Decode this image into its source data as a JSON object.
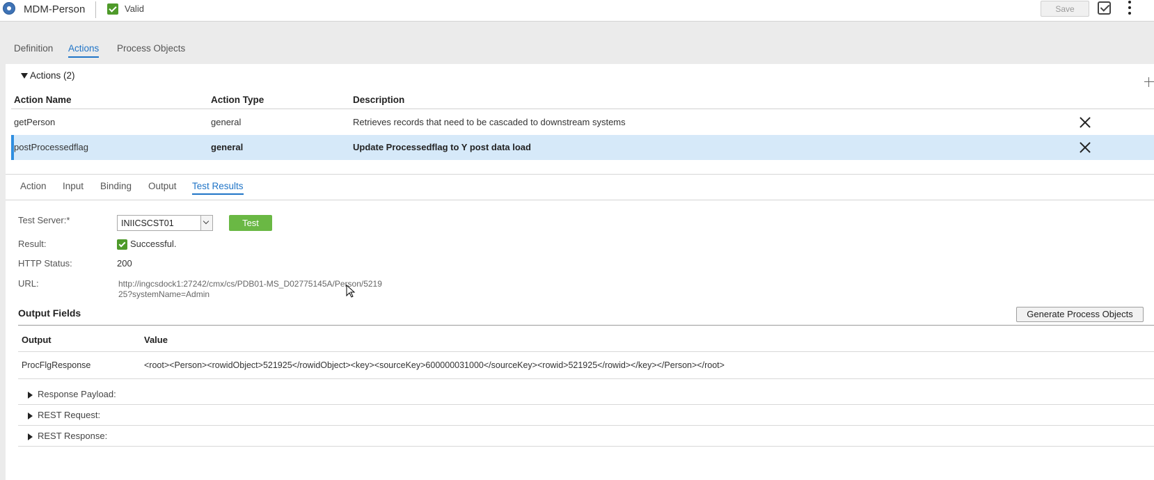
{
  "topbar": {
    "app_title": "MDM-Person",
    "status": "Valid",
    "save_label": "Save",
    "icons": [
      "app-logo-icon",
      "check-icon",
      "validate-icon",
      "kebab-menu-icon"
    ]
  },
  "main_tabs": [
    "Definition",
    "Actions",
    "Process Objects"
  ],
  "main_active_tab": "Actions",
  "actions_section": {
    "title": "Actions (2)",
    "columns": [
      "Action Name",
      "Action Type",
      "Description"
    ],
    "rows": [
      {
        "name": "getPerson",
        "type": "general",
        "description": "Retrieves records that need to be cascaded to downstream systems"
      },
      {
        "name": "postProcessedflag",
        "type": "general",
        "description": "Update Processedflag to Y post data load"
      }
    ],
    "selected_row": "postProcessedflag"
  },
  "sub_tabs": [
    "Action",
    "Input",
    "Binding",
    "Output",
    "Test Results"
  ],
  "sub_active_tab": "Test Results",
  "test_results": {
    "server_label": "Test Server:*",
    "server_value": "INIICSCST01",
    "test_button": "Test",
    "result_label": "Result:",
    "result_value": "Successful.",
    "http_status_label": "HTTP Status:",
    "http_status_value": "200",
    "url_label": "URL:",
    "url_value": "http://ingcsdock1:27242/cmx/cs/PDB01-MS_D02775145A/Person/521925?systemName=Admin"
  },
  "output_fields": {
    "title": "Output Fields",
    "generate_button": "Generate Process Objects",
    "columns": [
      "Output",
      "Value"
    ],
    "rows": [
      {
        "output": "ProcFlgResponse",
        "value": "<root><Person><rowidObject>521925</rowidObject><key><sourceKey>600000031000</sourceKey><rowid>521925</rowid></key></Person></root>"
      }
    ]
  },
  "collapsed_sections": [
    "Response Payload:",
    "REST Request:",
    "REST Response:"
  ],
  "colors": {
    "accent": "#1f74c7",
    "success": "#4e9a2a",
    "test_button": "#6ab844",
    "selected_row": "#d6e9f9"
  }
}
